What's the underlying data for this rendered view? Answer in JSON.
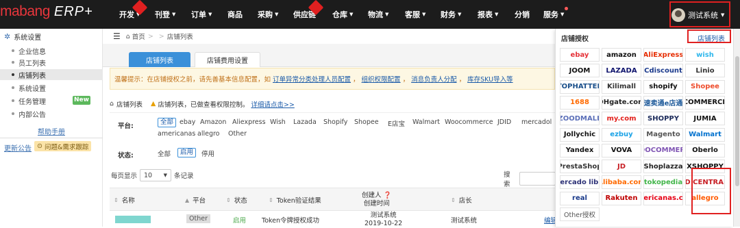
{
  "header": {
    "logo_main": "mabang",
    "logo_sub": "ERP+",
    "nav": [
      {
        "label": "开发",
        "caret": true,
        "hot": true
      },
      {
        "label": "刊登",
        "caret": true
      },
      {
        "label": "订单",
        "caret": true
      },
      {
        "label": "商品",
        "caret": false
      },
      {
        "label": "采购",
        "caret": true
      },
      {
        "label": "供应链",
        "caret": false,
        "hot": true
      },
      {
        "label": "仓库",
        "caret": true
      },
      {
        "label": "物流",
        "caret": true
      },
      {
        "label": "客服",
        "caret": true
      },
      {
        "label": "财务",
        "caret": true
      },
      {
        "label": "报表",
        "caret": true
      },
      {
        "label": "分销",
        "caret": false
      },
      {
        "label": "服务",
        "caret": true,
        "dot": true
      }
    ],
    "user": "测试系统"
  },
  "sidebar": {
    "section": "系统设置",
    "items": [
      "企业信息",
      "员工列表",
      "店铺列表",
      "系统设置",
      "任务管理",
      "内部公告"
    ],
    "active_index": 2,
    "new_badge": "New",
    "help": "帮助手册",
    "announce": "更新公告",
    "issue": "问题&需求跟踪"
  },
  "main": {
    "breadcrumb": {
      "home": "首页",
      "sep": ">",
      "current": "店铺列表"
    },
    "tabs": [
      "店铺列表",
      "店铺费用设置"
    ],
    "tip": {
      "prefix": "温馨提示：在店铺授权之前，请先善基本信息配置，如",
      "links": [
        "订单异常分类处理人员配置",
        "组织权限配置",
        "消息负责人分配",
        "库存SKU导入等"
      ],
      "sep": "，"
    },
    "crumb2": {
      "label": "店铺列表",
      "warning": "店铺列表，已做查看权限控制。",
      "link": "详细请点击>>"
    },
    "filter": {
      "platform_label": "平台:",
      "platforms_row1": [
        "全部",
        "ebay",
        "Amazon",
        "Aliexpress",
        "Wish",
        "Lazada",
        "Shopify",
        "Shopee",
        "E店宝",
        "Walmart",
        "Woocommerce",
        "JDID",
        "mercadol"
      ],
      "platforms_row2": [
        "americanas",
        "allegro",
        "Other"
      ],
      "status_label": "状态:",
      "statuses": [
        "全部",
        "启用",
        "停用"
      ]
    },
    "pager": {
      "prefix": "每页显示",
      "size": "10",
      "suffix": "条记录"
    },
    "search_label": "搜索",
    "table": {
      "headers": [
        "名称",
        "平台",
        "状态",
        "Token验证结果",
        "创建人",
        "创建时间",
        "店长"
      ],
      "row": {
        "platform": "Other",
        "status": "启用",
        "token": "Token令牌授权成功",
        "creator": "测试系统",
        "date": "2019-10-22",
        "manager": "测试系统",
        "action": "编辑"
      }
    }
  },
  "panel": {
    "title": "店铺授权",
    "link": "店铺列表",
    "platforms": [
      {
        "name": "ebay",
        "color": "#e53238"
      },
      {
        "name": "amazon",
        "color": "#111111"
      },
      {
        "name": "AliExpress",
        "color": "#e62e04"
      },
      {
        "name": "wish",
        "color": "#2fb7ec"
      },
      {
        "name": "JOOM",
        "color": "#111111"
      },
      {
        "name": "LAZADA",
        "color": "#0f146d"
      },
      {
        "name": "Cdiscount",
        "color": "#1b3a8c"
      },
      {
        "name": "Linio",
        "color": "#333333"
      },
      {
        "name": "TOPHATTER",
        "color": "#1a4f8a"
      },
      {
        "name": "Kilimall",
        "color": "#333333"
      },
      {
        "name": "shopify",
        "color": "#111111"
      },
      {
        "name": "Shopee",
        "color": "#ee4d2d"
      },
      {
        "name": "1688",
        "color": "#ff6a00"
      },
      {
        "name": "DHgate.com",
        "color": "#222222"
      },
      {
        "name": "速卖通e店通",
        "color": "#1e5a9a"
      },
      {
        "name": "COMMERCE",
        "color": "#111111"
      },
      {
        "name": "ZOODMALL",
        "color": "#5b6fb8"
      },
      {
        "name": "my.com",
        "color": "#e2211c"
      },
      {
        "name": "SHOPPY",
        "color": "#1b2a5a"
      },
      {
        "name": "JUMIA",
        "color": "#111111"
      },
      {
        "name": "Jollychic",
        "color": "#111111"
      },
      {
        "name": "ezbuy",
        "color": "#1aa2e6"
      },
      {
        "name": "Magento",
        "color": "#555555"
      },
      {
        "name": "Walmart",
        "color": "#0071ce"
      },
      {
        "name": "Yandex",
        "color": "#111111"
      },
      {
        "name": "VOVA",
        "color": "#111111"
      },
      {
        "name": "WOOCOMMERCE",
        "color": "#7f54b3"
      },
      {
        "name": "Oberlo",
        "color": "#111111"
      },
      {
        "name": "PrestaShop",
        "color": "#333333"
      },
      {
        "name": "JD",
        "color": "#c71d23"
      },
      {
        "name": "Shoplazza",
        "color": "#222222"
      },
      {
        "name": "XSHOPPY",
        "color": "#111111"
      },
      {
        "name": "mercado libre",
        "color": "#2d3277"
      },
      {
        "name": "Alibaba.com",
        "color": "#ff6a00"
      },
      {
        "name": "tokopedia",
        "color": "#42b549"
      },
      {
        "name": "JD CENTRAL",
        "color": "#c71d23"
      },
      {
        "name": "real",
        "color": "#1a3a8a"
      },
      {
        "name": "Rakuten",
        "color": "#bf0000"
      },
      {
        "name": "americanas.com",
        "color": "#e60014"
      },
      {
        "name": "allegro",
        "color": "#ff5a00"
      },
      {
        "name": "Other授权",
        "color": "#555555"
      }
    ]
  }
}
